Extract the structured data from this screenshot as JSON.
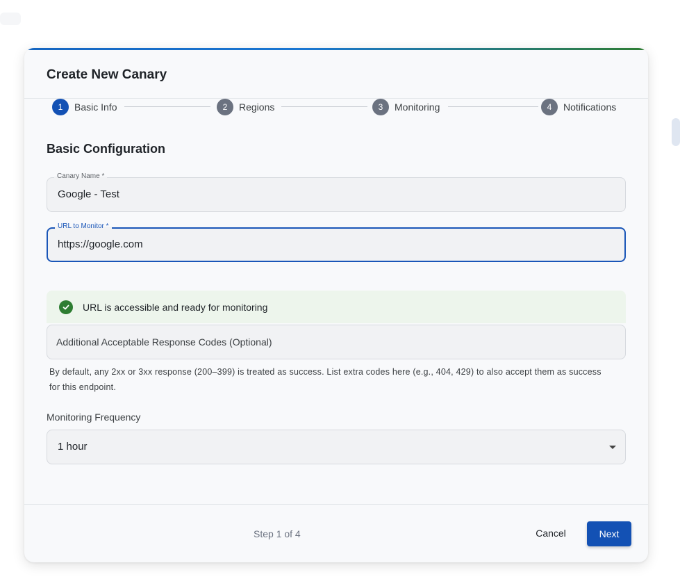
{
  "dialog": {
    "title": "Create New Canary",
    "accent_colors": [
      "#1565c0",
      "#2e7d32"
    ]
  },
  "stepper": {
    "steps": [
      {
        "number": "1",
        "label": "Basic Info",
        "active": true
      },
      {
        "number": "2",
        "label": "Regions",
        "active": false
      },
      {
        "number": "3",
        "label": "Monitoring",
        "active": false
      },
      {
        "number": "4",
        "label": "Notifications",
        "active": false
      }
    ]
  },
  "form": {
    "section_title": "Basic Configuration",
    "canary_name": {
      "label": "Canary Name *",
      "value": "Google - Test"
    },
    "url": {
      "label": "URL to Monitor *",
      "value": "https://google.com"
    },
    "validation": {
      "message": "URL is accessible and ready for monitoring",
      "icon": "check-circle-icon",
      "color": "#2e7d32"
    },
    "response_codes": {
      "placeholder": "Additional Acceptable Response Codes (Optional)",
      "helper": "By default, any 2xx or 3xx response (200–399) is treated as success. List extra codes here (e.g., 404, 429) to also accept them as success for this endpoint."
    },
    "frequency": {
      "label": "Monitoring Frequency",
      "value": "1 hour",
      "icon": "dropdown-caret-icon"
    }
  },
  "footer": {
    "step_counter": "Step 1 of 4",
    "cancel_label": "Cancel",
    "next_label": "Next",
    "primary_color": "#1351b4"
  }
}
